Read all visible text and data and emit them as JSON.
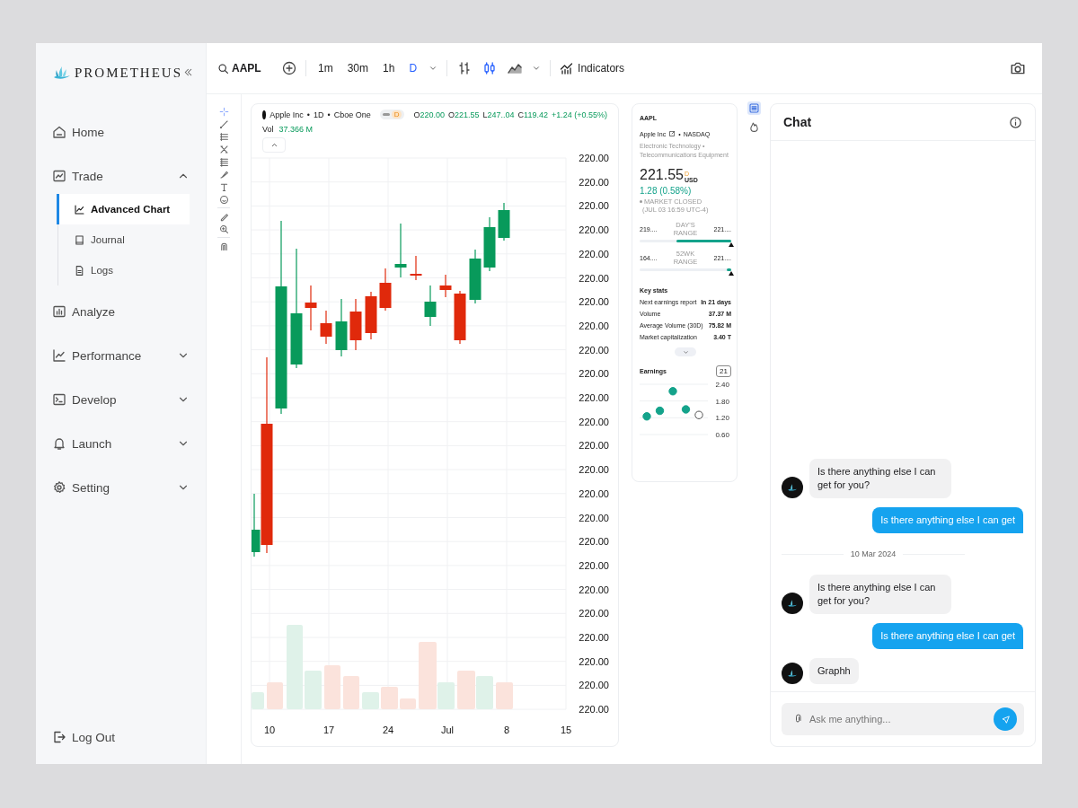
{
  "brand": "PROMETHEUS",
  "sidebar": {
    "items": [
      {
        "label": "Home",
        "kind": "link"
      },
      {
        "label": "Trade",
        "kind": "group",
        "expanded": true,
        "children": [
          {
            "label": "Advanced Chart",
            "selected": true
          },
          {
            "label": "Journal",
            "selected": false
          },
          {
            "label": "Logs",
            "selected": false
          }
        ]
      },
      {
        "label": "Analyze",
        "kind": "link"
      },
      {
        "label": "Performance",
        "kind": "group",
        "expanded": false
      },
      {
        "label": "Develop",
        "kind": "group",
        "expanded": false
      },
      {
        "label": "Launch",
        "kind": "group",
        "expanded": false
      },
      {
        "label": "Setting",
        "kind": "group",
        "expanded": false
      }
    ],
    "logout": "Log Out"
  },
  "toolbar": {
    "symbol": "AAPL",
    "timeframes": [
      {
        "label": "1m",
        "selected": false
      },
      {
        "label": "30m",
        "selected": false
      },
      {
        "label": "1h",
        "selected": false
      },
      {
        "label": "D",
        "selected": true
      }
    ],
    "chart_types": [
      {
        "kind": "bars",
        "selected": false
      },
      {
        "kind": "candles",
        "selected": true
      },
      {
        "kind": "area",
        "selected": false
      }
    ],
    "indicators": "Indicators"
  },
  "drawing_tools": [
    {
      "kind": "crosshair",
      "selected": true
    },
    {
      "kind": "line",
      "selected": false
    },
    {
      "kind": "channel",
      "selected": false
    },
    {
      "kind": "pattern",
      "selected": false
    },
    {
      "kind": "fib",
      "selected": false
    },
    {
      "kind": "brush",
      "selected": false
    },
    {
      "kind": "text",
      "selected": false
    },
    {
      "kind": "emoji",
      "selected": false
    },
    {
      "kind": "ruler",
      "selected": false
    },
    {
      "kind": "zoom",
      "selected": false
    },
    {
      "kind": "magnet",
      "selected": false
    }
  ],
  "chart": {
    "legend": [
      "Apple Inc",
      "•",
      "1D",
      "•",
      "Cboe One"
    ],
    "badge": "D",
    "ohlc": [
      {
        "label": "O",
        "value": "220.00"
      },
      {
        "label": "O",
        "value": "221.55"
      },
      {
        "label": "L",
        "value": "247..04"
      },
      {
        "label": "C",
        "value": "119.42"
      }
    ],
    "change": "+1.24 (+0.55%)",
    "vol_label": "Vol",
    "vol_value": "37.366 M",
    "price_labels": [
      "220.00",
      "220.00",
      "220.00",
      "220.00",
      "220.00",
      "220.00",
      "220.00",
      "220.00",
      "220.00",
      "220.00",
      "220.00",
      "220.00",
      "220.00",
      "220.00",
      "220.00",
      "220.00",
      "220.00",
      "220.00",
      "220.00",
      "220.00",
      "220.00",
      "220.00",
      "220.00",
      "220.00"
    ],
    "date_labels": [
      "10",
      "17",
      "24",
      "Jul",
      "8",
      "15"
    ]
  },
  "info": {
    "symbol": "AAPL",
    "company_line": [
      "Apple Inc",
      "•",
      "NASDAQ"
    ],
    "sector": "Electronic Technology • Telecommunications Equipment",
    "price": "221.55",
    "price_badge": "D",
    "currency": "USD",
    "change": "1.28 (0.58%)",
    "status": "MARKET CLOSED",
    "time": "(JUL 03 16:59 UTC-4)",
    "ranges": [
      {
        "low": "219....",
        "label": "DAY'S RANGE",
        "high": "221....",
        "level": 0.6
      },
      {
        "low": "164....",
        "label": "52WK RANGE",
        "high": "221....",
        "level": 0.05
      }
    ],
    "key_stats_title": "Key stats",
    "key_stats": [
      {
        "label": "Next earnings report",
        "value": "In 21 days"
      },
      {
        "label": "Volume",
        "value": "37.37 M"
      },
      {
        "label": "Average Volume (30D)",
        "value": "75.82 M"
      },
      {
        "label": "Market capitalization",
        "value": "3.40 T"
      }
    ],
    "earnings_title": "Earnings",
    "earnings_badge": "21",
    "chart_data": {
      "type": "scatter",
      "series": [
        {
          "color": "#14a38b",
          "values": [
            1.25,
            1.45,
            2.15,
            1.5,
            null
          ]
        },
        {
          "color": "#ffffff",
          "values": [
            null,
            null,
            null,
            null,
            1.3
          ]
        }
      ],
      "ylim": [
        0.6,
        2.4
      ],
      "yticks": [
        {
          "value": 2.4,
          "label": "2.40"
        },
        {
          "value": 1.8,
          "label": "1.80"
        },
        {
          "value": 1.2,
          "label": "1.20"
        },
        {
          "value": 0.6,
          "label": "0.60"
        }
      ]
    }
  },
  "side_tabs": [
    {
      "kind": "details",
      "selected": true
    },
    {
      "kind": "hot",
      "selected": false
    }
  ],
  "chat": {
    "title": "Chat",
    "messages": [
      {
        "kind": "bot",
        "text": "Is there anything else I can get for you?"
      },
      {
        "kind": "user",
        "text": "Is there anything else I can get"
      },
      {
        "kind": "divider",
        "text": "10 Mar 2024"
      },
      {
        "kind": "bot",
        "text": "Is there anything else I can get for you?"
      },
      {
        "kind": "user",
        "text": "Is there anything else I can get"
      },
      {
        "kind": "bot",
        "text": "Graphh"
      }
    ],
    "input": {
      "placeholder": "Ask me anything..."
    }
  }
}
